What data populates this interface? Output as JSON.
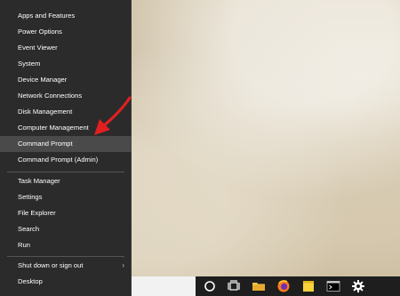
{
  "menu": {
    "items": [
      {
        "label": "Apps and Features"
      },
      {
        "label": "Power Options"
      },
      {
        "label": "Event Viewer"
      },
      {
        "label": "System"
      },
      {
        "label": "Device Manager"
      },
      {
        "label": "Network Connections"
      },
      {
        "label": "Disk Management"
      },
      {
        "label": "Computer Management"
      },
      {
        "label": "Command Prompt"
      },
      {
        "label": "Command Prompt (Admin)"
      },
      {
        "label": "Task Manager"
      },
      {
        "label": "Settings"
      },
      {
        "label": "File Explorer"
      },
      {
        "label": "Search"
      },
      {
        "label": "Run"
      },
      {
        "label": "Shut down or sign out"
      },
      {
        "label": "Desktop"
      }
    ],
    "highlighted_item": "Command Prompt",
    "submenu_arrow": "›"
  },
  "taskbar": {
    "icons": [
      "cortana-icon",
      "task-view-icon",
      "file-explorer-icon",
      "firefox-icon",
      "sticky-notes-icon",
      "terminal-icon",
      "settings-gear-icon"
    ]
  },
  "colors": {
    "menu_background": "#2b2b2b",
    "menu_hover": "#4a4a4a",
    "menu_text": "#ffffff",
    "annotation_arrow": "#e02020",
    "taskbar": "#1e1e1e"
  }
}
